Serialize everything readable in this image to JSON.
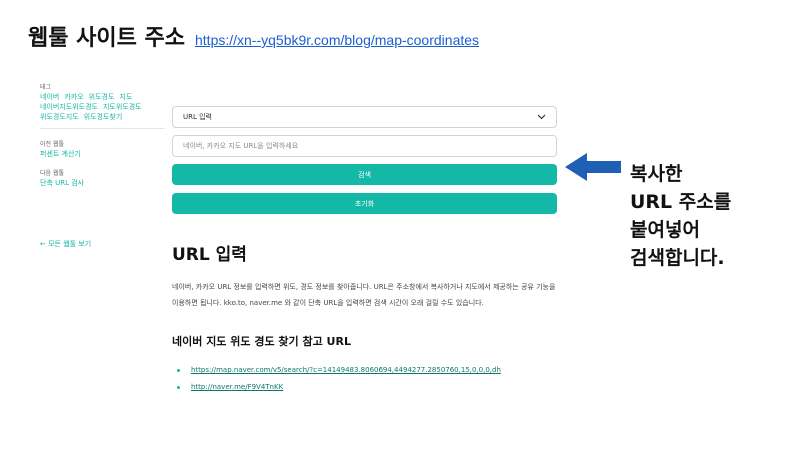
{
  "slide": {
    "title": "웹툴 사이트 주소",
    "url": "https://xn--yq5bk9r.com/blog/map-coordinates"
  },
  "sidebar": {
    "tags_label": "태그",
    "tags": [
      "네이버",
      "카카오",
      "위도경도",
      "지도",
      "네이버지도위도경도",
      "지도위도경도",
      "위도경도지도",
      "위도경도찾기"
    ],
    "prev_label": "이전 웹툴",
    "prev_link": "퍼센트 계산기",
    "next_label": "다음 웹툴",
    "next_link": "단축 URL 검사",
    "back_link": "← 모든 웹툴 보기"
  },
  "form": {
    "select_value": "URL 입력",
    "input_placeholder": "네이버, 카카오 지도 URL을 입력하세요",
    "input_value": "",
    "search_label": "검색",
    "reset_label": "초기화"
  },
  "content": {
    "heading": "URL 입력",
    "description": "네이버, 카카오 URL 정보를 입력하면 위도, 경도 정보를 찾아줍니다. URL은 주소창에서 복사하거나 지도에서 제공하는 공유 기능을 이용하면 됩니다. kko.to, naver.me 와 같이 단축 URL을 입력하면 검색 시간이 오래 걸릴 수도 있습니다.",
    "ref_heading": "네이버 지도 위도 경도 찾기 참고 URL",
    "ref_links": [
      "https://map.naver.com/v5/search/?c=14149483.8060694,4494277.2850760,15,0,0,0,dh",
      "http://naver.me/F9V4TnKK"
    ]
  },
  "annotation": {
    "lines": [
      "복사한",
      "URL 주소를",
      "붙여넣어",
      "검색합니다."
    ],
    "arrow_color": "#1f5fb4"
  },
  "colors": {
    "accent": "#14b8a6",
    "title_link": "#1a5fd0"
  }
}
